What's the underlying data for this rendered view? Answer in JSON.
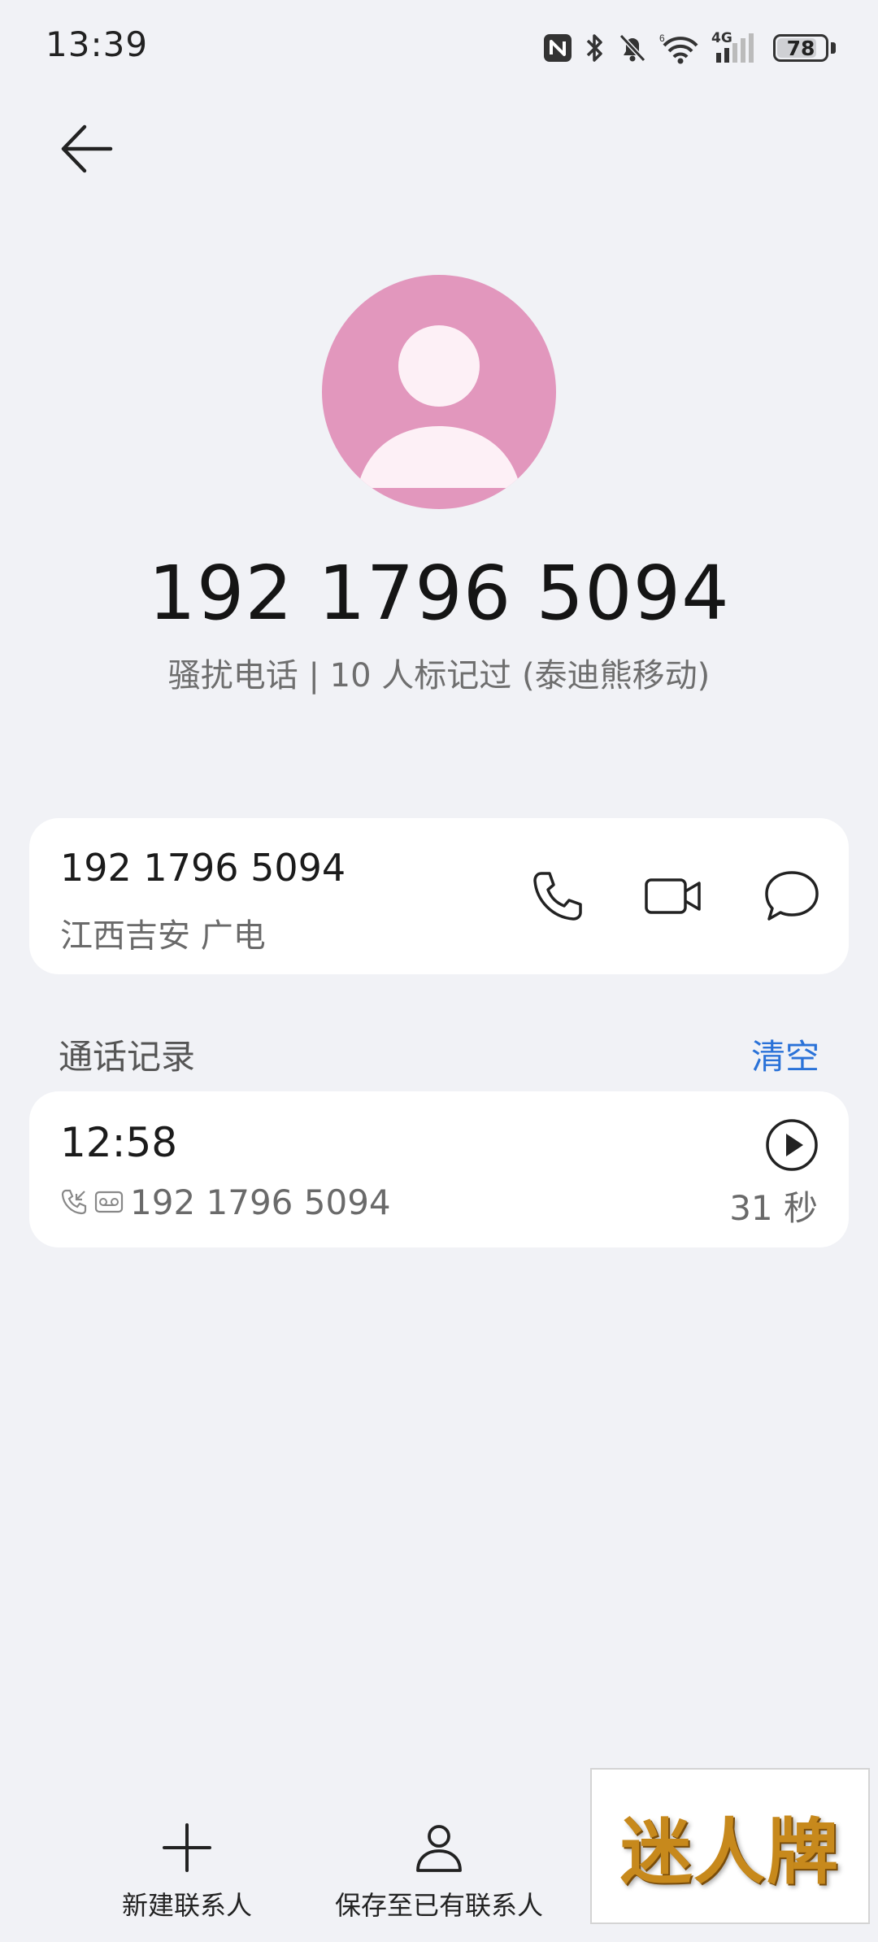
{
  "status_bar": {
    "time": "13:39",
    "network": "4G",
    "battery": "78",
    "icons": [
      "nfc-icon",
      "bluetooth-icon",
      "bell-muted-icon",
      "wifi-icon",
      "signal-icon",
      "battery-icon"
    ]
  },
  "contact": {
    "number": "192 1796 5094",
    "tag": "骚扰电话 | 10 人标记过 (泰迪熊移动)",
    "avatar_color": "#e297bd"
  },
  "number_card": {
    "number": "192 1796 5094",
    "location": "江西吉安 广电",
    "actions": [
      "phone-icon",
      "video-icon",
      "message-icon"
    ]
  },
  "call_log": {
    "title": "通话记录",
    "clear_label": "清空",
    "entries": [
      {
        "time": "12:58",
        "number": "192 1796 5094",
        "duration": "31 秒"
      }
    ]
  },
  "bottom": {
    "new_contact": "新建联系人",
    "save_existing": "保存至已有联系人"
  },
  "badge": {
    "text": "迷人牌"
  },
  "colors": {
    "accent": "#2a72d8",
    "background": "#f1f2f6",
    "card": "#ffffff"
  }
}
